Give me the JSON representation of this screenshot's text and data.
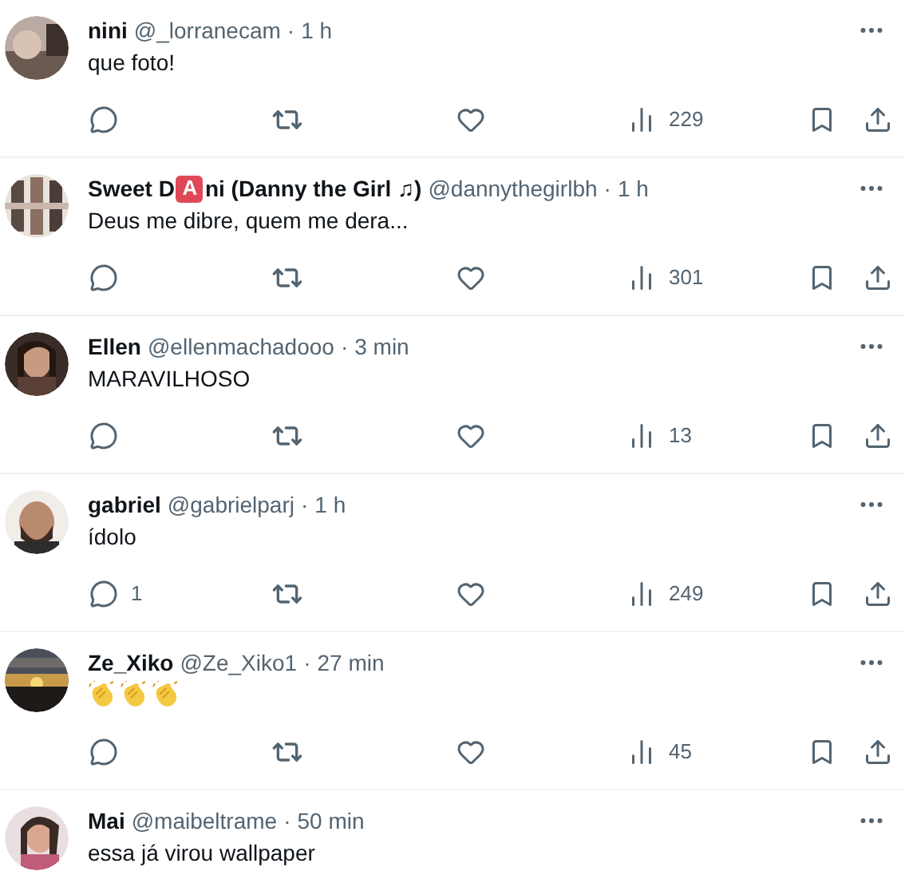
{
  "replies": [
    {
      "name_parts": [
        {
          "kind": "text",
          "text": "nini"
        }
      ],
      "handle": "@_lorranecam",
      "separator": "·",
      "time": "1 h",
      "text": "que foto!",
      "actions": {
        "views": "229"
      }
    },
    {
      "name_parts": [
        {
          "kind": "text",
          "text": "Sweet D"
        },
        {
          "kind": "letter-badge",
          "text": "A"
        },
        {
          "kind": "text",
          "text": "ni (Danny the Girl ♫)"
        }
      ],
      "handle": "@dannythegirlbh",
      "separator": "·",
      "time": "1 h",
      "text": "Deus me dibre, quem me dera...",
      "actions": {
        "views": "301"
      }
    },
    {
      "name_parts": [
        {
          "kind": "text",
          "text": "Ellen"
        }
      ],
      "handle": "@ellenmachadooo",
      "separator": "·",
      "time": "3 min",
      "text": "MARAVILHOSO",
      "actions": {
        "views": "13"
      }
    },
    {
      "name_parts": [
        {
          "kind": "text",
          "text": "gabriel"
        }
      ],
      "handle": "@gabrielparj",
      "separator": "·",
      "time": "1 h",
      "text": "ídolo",
      "actions": {
        "replies": "1",
        "views": "249"
      }
    },
    {
      "name_parts": [
        {
          "kind": "text",
          "text": "Ze_Xiko"
        }
      ],
      "handle": "@Ze_Xiko1",
      "separator": "·",
      "time": "27 min",
      "emojis": [
        {
          "kind": "clap"
        },
        {
          "kind": "clap"
        },
        {
          "kind": "clap"
        }
      ],
      "actions": {
        "views": "45"
      }
    },
    {
      "name_parts": [
        {
          "kind": "text",
          "text": "Mai"
        }
      ],
      "handle": "@maibeltrame",
      "separator": "·",
      "time": "50 min",
      "text": "essa já virou wallpaper"
    }
  ]
}
